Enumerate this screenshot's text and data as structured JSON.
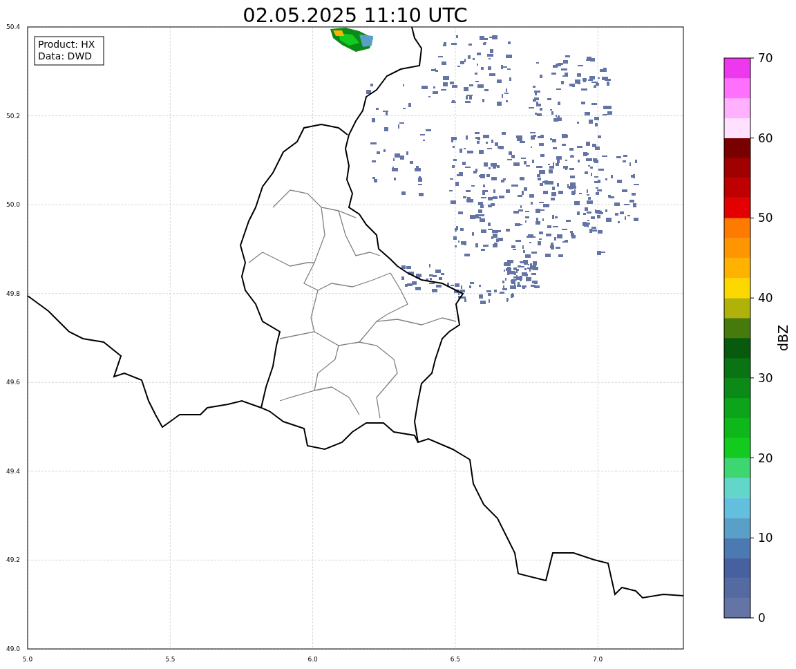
{
  "title": "02.05.2025 11:10 UTC",
  "info_box": [
    "Product: HX",
    "Data: DWD"
  ],
  "x_axis": {
    "ticks": [
      "5.0",
      "5.5",
      "6.0",
      "6.5",
      "7.0"
    ]
  },
  "y_axis": {
    "ticks": [
      "50.4",
      "50.2",
      "50.0",
      "49.8",
      "49.6",
      "49.4",
      "49.2",
      "49.0"
    ]
  },
  "colorbar": {
    "label": "dBZ",
    "ticks": [
      "70",
      "60",
      "50",
      "40",
      "30",
      "20",
      "10",
      "0"
    ],
    "segments": [
      {
        "color": "#6475a5"
      },
      {
        "color": "#566aa2"
      },
      {
        "color": "#4660a0"
      },
      {
        "color": "#4b7ab2"
      },
      {
        "color": "#5a9fc8"
      },
      {
        "color": "#62bfdd"
      },
      {
        "color": "#62d7c9"
      },
      {
        "color": "#3dd670"
      },
      {
        "color": "#12cb1e"
      },
      {
        "color": "#0eb81a"
      },
      {
        "color": "#0ca41a"
      },
      {
        "color": "#0c8a18"
      },
      {
        "color": "#0a7314"
      },
      {
        "color": "#085b0e"
      },
      {
        "color": "#467a0c"
      },
      {
        "color": "#b0b20a"
      },
      {
        "color": "#fdd800"
      },
      {
        "color": "#ffb300"
      },
      {
        "color": "#ff9600"
      },
      {
        "color": "#ff7a00"
      },
      {
        "color": "#e40000"
      },
      {
        "color": "#c00000"
      },
      {
        "color": "#a00000"
      },
      {
        "color": "#7a0000"
      },
      {
        "color": "#ffe0ff"
      },
      {
        "color": "#ffb0ff"
      },
      {
        "color": "#ff70ff"
      },
      {
        "color": "#ee38ee"
      }
    ]
  }
}
